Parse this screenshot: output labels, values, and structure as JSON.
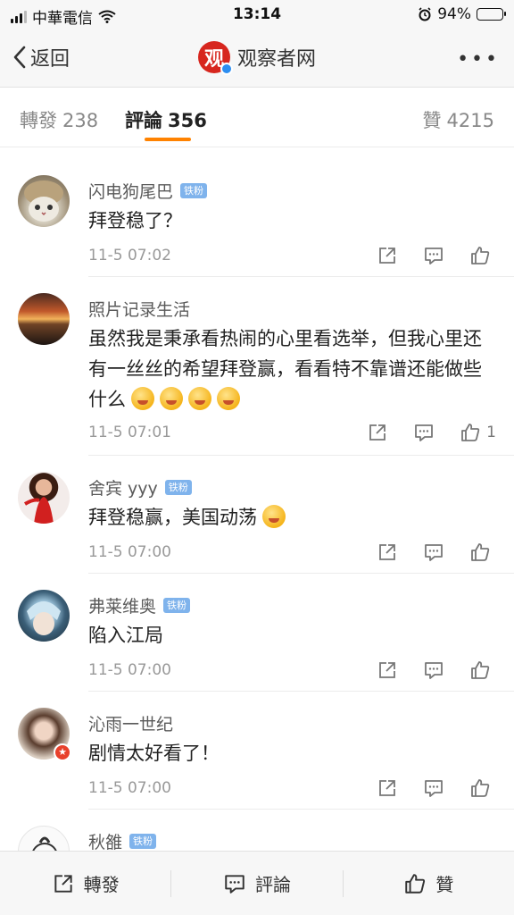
{
  "status_bar": {
    "carrier": "中華電信",
    "time": "13:14",
    "battery": "94%"
  },
  "nav": {
    "back_label": "返回",
    "brand_initial": "观",
    "title": "观察者网"
  },
  "tabs": [
    {
      "label": "轉發",
      "count": "238"
    },
    {
      "label": "評論",
      "count": "356"
    },
    {
      "label": "贊",
      "count": "4215"
    }
  ],
  "comments": [
    {
      "name": "闪电狗尾巴",
      "badge": "铁粉",
      "text": "拜登稳了？",
      "time": "11-5 07:02",
      "likes": ""
    },
    {
      "name": "照片记录生活",
      "badge": "",
      "text": "虽然我是秉承看热闹的心里看选举，但我心里还有一丝丝的希望拜登赢，看看特不靠谱还能做些什么",
      "time": "11-5 07:01",
      "likes": "1"
    },
    {
      "name": "舍宾 yyy",
      "badge": "铁粉",
      "text": "拜登稳赢，美国动荡",
      "time": "11-5 07:00",
      "likes": ""
    },
    {
      "name": "弗莱维奥",
      "badge": "铁粉",
      "text": "陷入江局",
      "time": "11-5 07:00",
      "likes": ""
    },
    {
      "name": "沁雨一世纪",
      "badge": "",
      "text": "剧情太好看了！",
      "time": "11-5 07:00",
      "likes": ""
    },
    {
      "name": "秋雒",
      "badge": "铁粉",
      "text": "",
      "time": "",
      "likes": ""
    }
  ],
  "bottom_bar": {
    "repost": "轉發",
    "comment": "評論",
    "like": "贊"
  },
  "colors": {
    "accent": "#ff8200",
    "brand_red": "#d7261e",
    "badge_blue": "#7fb3ec"
  }
}
